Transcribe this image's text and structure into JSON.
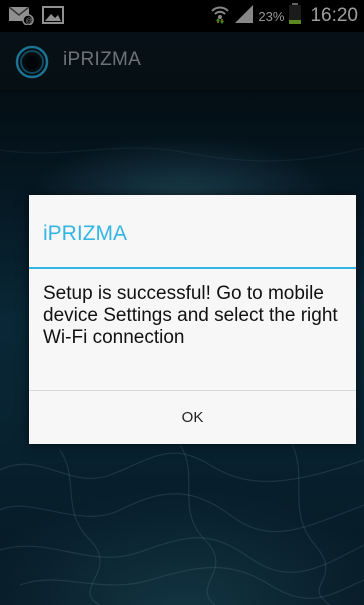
{
  "status_bar": {
    "battery_percent": "23%",
    "time": "16:20",
    "icons": [
      "email-notification-icon",
      "picture-notification-icon",
      "wifi-icon",
      "signal-icon",
      "battery-icon"
    ],
    "battery_level": 0.23,
    "battery_color": "#8fd12e"
  },
  "app_bar": {
    "title": "iPRIZMA",
    "logo": "ring-logo-icon"
  },
  "dialog": {
    "title": "iPRIZMA",
    "message": "Setup is successful! Go to mobile device Settings and select the right Wi-Fi connection",
    "ok_label": "OK",
    "accent_color": "#33b5e5"
  }
}
